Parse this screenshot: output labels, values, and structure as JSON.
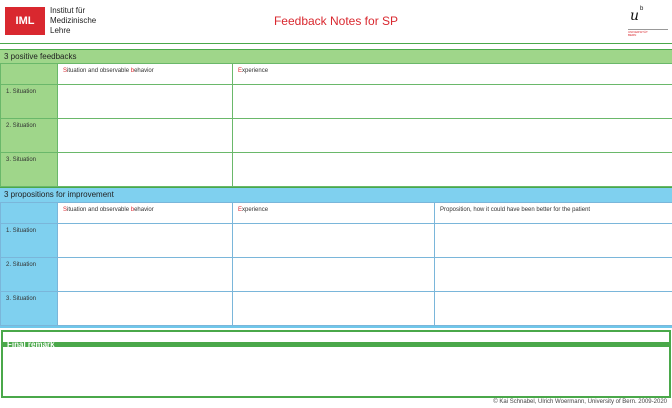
{
  "header": {
    "logo": "IML",
    "institute": "Institut für\nMedizinische\nLehre",
    "title": "Feedback Notes for SP",
    "unibe_letter": "u",
    "unibe_sup": "b",
    "unibe_sub": "UNIVERSITÄT\nBERN"
  },
  "positive": {
    "title": "3 positive feedbacks",
    "col1_first": "S",
    "col1_rest_a": "ituation and observable ",
    "col1_b": "b",
    "col1_rest_b": "ehavior",
    "col2_first": "E",
    "col2_rest": "xperience",
    "rows": [
      "1. Situation",
      "2. Situation",
      "3. Situation"
    ]
  },
  "improve": {
    "title": "3 propositions for improvement",
    "col1_first": "S",
    "col1_rest_a": "ituation and observable ",
    "col1_b": "b",
    "col1_rest_b": "ehavior",
    "col2_first": "E",
    "col2_rest": "xperience",
    "col3": "Proposition, how it could have been better for the patient",
    "rows": [
      "1. Situation",
      "2. Situation",
      "3. Situation"
    ]
  },
  "final": {
    "title": "Final remark"
  },
  "footer": "© Kai Schnabel, Ulrich Woermann, University of Bern. 2009-2020",
  "colors": {
    "brand_red": "#d9282f",
    "green": "#9fd68a",
    "blue": "#7fd0ef"
  }
}
